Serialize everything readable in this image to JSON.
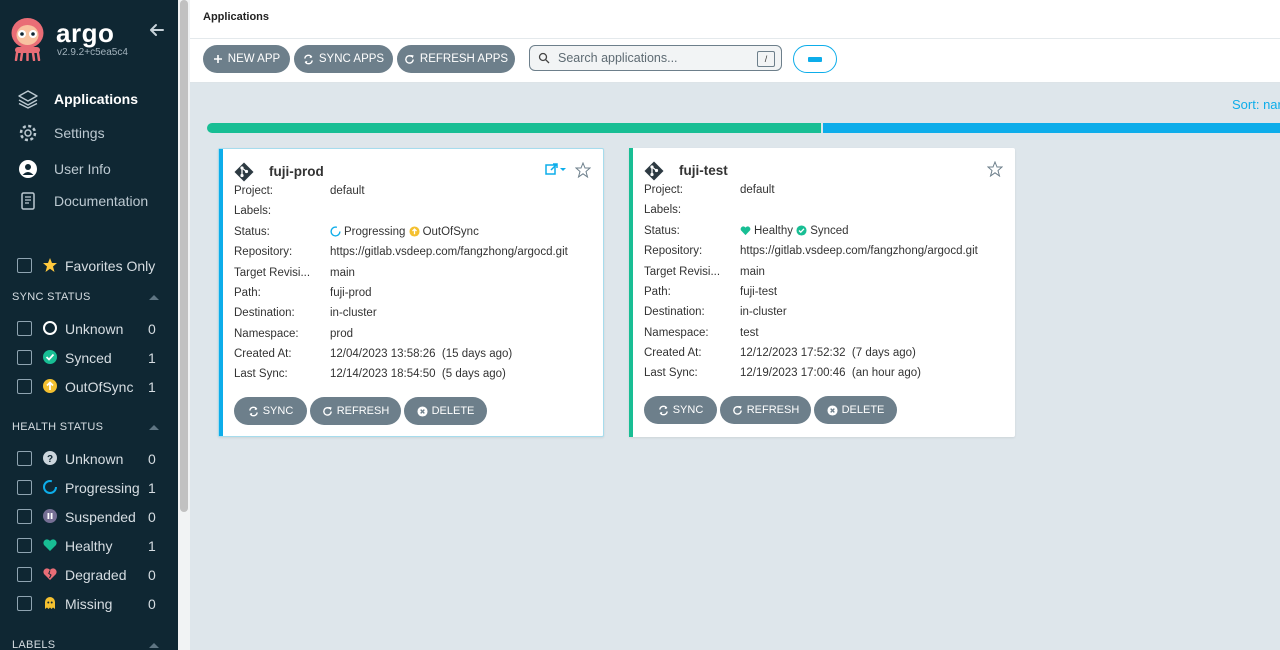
{
  "brand": {
    "title": "argo",
    "version": "v2.9.2+c5ea5c4"
  },
  "nav": [
    {
      "label": "Applications",
      "icon": "layers-icon",
      "active": true
    },
    {
      "label": "Settings",
      "icon": "gear-icon"
    },
    {
      "label": "User Info",
      "icon": "user-icon"
    },
    {
      "label": "Documentation",
      "icon": "book-icon"
    }
  ],
  "favorites_label": "Favorites Only",
  "sync_status": {
    "title": "SYNC STATUS",
    "items": [
      {
        "label": "Unknown",
        "count": "0",
        "icon": "circle-outline-icon"
      },
      {
        "label": "Synced",
        "count": "1",
        "icon": "check-circle-icon"
      },
      {
        "label": "OutOfSync",
        "count": "1",
        "icon": "arrow-up-circle-icon"
      }
    ]
  },
  "health_status": {
    "title": "HEALTH STATUS",
    "items": [
      {
        "label": "Unknown",
        "count": "0",
        "icon": "question-circle-icon"
      },
      {
        "label": "Progressing",
        "count": "1",
        "icon": "spinner-icon"
      },
      {
        "label": "Suspended",
        "count": "0",
        "icon": "pause-circle-icon"
      },
      {
        "label": "Healthy",
        "count": "1",
        "icon": "heart-icon"
      },
      {
        "label": "Degraded",
        "count": "0",
        "icon": "broken-heart-icon"
      },
      {
        "label": "Missing",
        "count": "0",
        "icon": "ghost-icon"
      }
    ]
  },
  "labels_section": {
    "title": "LABELS"
  },
  "header": {
    "breadcrumb": "Applications"
  },
  "toolbar": {
    "new_app": "NEW APP",
    "sync_apps": "SYNC APPS",
    "refresh_apps": "REFRESH APPS",
    "search_placeholder": "Search applications...",
    "search_shortcut": "/"
  },
  "sort_label": "Sort: nar",
  "status_bar": {
    "healthy_fraction": 0.5,
    "progressing_fraction": 0.5
  },
  "field_labels": {
    "project": "Project:",
    "labels": "Labels:",
    "status": "Status:",
    "repository": "Repository:",
    "target_revision": "Target Revisi...",
    "path": "Path:",
    "destination": "Destination:",
    "namespace": "Namespace:",
    "created_at": "Created At:",
    "last_sync": "Last Sync:"
  },
  "card_buttons": {
    "sync": "SYNC",
    "refresh": "REFRESH",
    "delete": "DELETE"
  },
  "apps": [
    {
      "name": "fuji-prod",
      "project": "default",
      "labels": "",
      "health": "Progressing",
      "sync": "OutOfSync",
      "repository": "https://gitlab.vsdeep.com/fangzhong/argocd.git",
      "target_revision": "main",
      "path": "fuji-prod",
      "destination": "in-cluster",
      "namespace": "prod",
      "created_at": "12/04/2023 13:58:26  (15 days ago)",
      "last_sync": "12/14/2023 18:54:50  (5 days ago)",
      "accent": "#0dadea"
    },
    {
      "name": "fuji-test",
      "project": "default",
      "labels": "",
      "health": "Healthy",
      "sync": "Synced",
      "repository": "https://gitlab.vsdeep.com/fangzhong/argocd.git",
      "target_revision": "main",
      "path": "fuji-test",
      "destination": "in-cluster",
      "namespace": "test",
      "created_at": "12/12/2023 17:52:32  (7 days ago)",
      "last_sync": "12/19/2023 17:00:46  (an hour ago)",
      "accent": "#18be94"
    }
  ]
}
